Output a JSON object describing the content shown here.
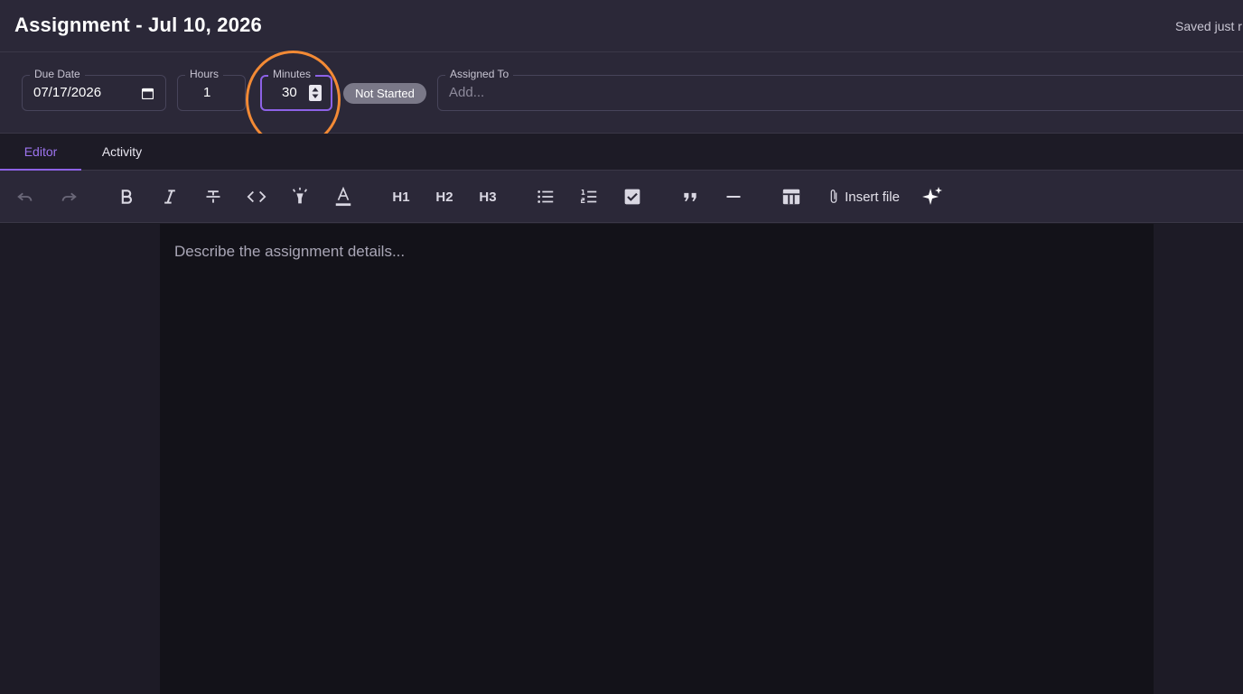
{
  "header": {
    "title": "Assignment - Jul 10, 2026",
    "save_status": "Saved just r"
  },
  "fields": {
    "due_date": {
      "label": "Due Date",
      "value": "07/17/2026"
    },
    "hours": {
      "label": "Hours",
      "value": "1"
    },
    "minutes": {
      "label": "Minutes",
      "value": "30"
    },
    "status": "Not Started",
    "assigned_to": {
      "label": "Assigned To",
      "placeholder": "Add..."
    }
  },
  "tabs": [
    {
      "label": "Editor",
      "active": true
    },
    {
      "label": "Activity",
      "active": false
    }
  ],
  "toolbar": {
    "h1": "H1",
    "h2": "H2",
    "h3": "H3",
    "insert_file": "Insert file",
    "icons": [
      "undo-icon",
      "redo-icon",
      "bold-icon",
      "italic-icon",
      "strikethrough-icon",
      "code-icon",
      "highlighter-icon",
      "text-color-icon",
      "bullet-list-icon",
      "numbered-list-icon",
      "checklist-icon",
      "quote-icon",
      "horizontal-rule-icon",
      "table-icon",
      "paperclip-icon",
      "sparkles-icon"
    ]
  },
  "editor": {
    "placeholder": "Describe the assignment details..."
  },
  "colors": {
    "accent": "#8d62e6",
    "highlight_ring": "#f38a35",
    "status_badge": "#7a7888"
  }
}
